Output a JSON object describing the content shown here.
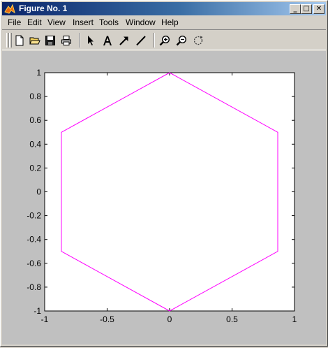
{
  "window": {
    "title": "Figure No. 1",
    "icons": {
      "app": "matlab-logo-icon",
      "minimize": "minimize-icon",
      "maximize": "maximize-icon",
      "close": "close-icon"
    },
    "controls": {
      "minimize": "_",
      "maximize": "□",
      "close": "✕"
    }
  },
  "menu": {
    "items": [
      {
        "label": "File",
        "name": "menu-file"
      },
      {
        "label": "Edit",
        "name": "menu-edit"
      },
      {
        "label": "View",
        "name": "menu-view"
      },
      {
        "label": "Insert",
        "name": "menu-insert"
      },
      {
        "label": "Tools",
        "name": "menu-tools"
      },
      {
        "label": "Window",
        "name": "menu-window"
      },
      {
        "label": "Help",
        "name": "menu-help"
      }
    ]
  },
  "toolbar": {
    "buttons": [
      {
        "name": "new-figure-button",
        "icon": "new-file-icon"
      },
      {
        "name": "open-file-button",
        "icon": "folder-open-icon"
      },
      {
        "name": "save-button",
        "icon": "floppy-disk-icon"
      },
      {
        "name": "print-button",
        "icon": "printer-icon"
      },
      {
        "name": "edit-plot-button",
        "icon": "arrow-pointer-icon"
      },
      {
        "name": "insert-text-button",
        "icon": "text-A-icon"
      },
      {
        "name": "insert-arrow-button",
        "icon": "arrow-icon"
      },
      {
        "name": "insert-line-button",
        "icon": "line-icon"
      },
      {
        "name": "zoom-in-button",
        "icon": "zoom-in-icon"
      },
      {
        "name": "zoom-out-button",
        "icon": "zoom-out-icon"
      },
      {
        "name": "rotate-3d-button",
        "icon": "rotate-icon"
      }
    ]
  },
  "colors": {
    "plot_line": "#ff00ff",
    "figure_bg": "#c0c0c0",
    "axes_bg": "#ffffff",
    "title_bar": "#0a246a"
  },
  "chart_data": {
    "type": "line",
    "title": "",
    "xlabel": "",
    "ylabel": "",
    "xlim": [
      -1,
      1
    ],
    "ylim": [
      -1,
      1
    ],
    "grid": false,
    "xticks": [
      -1,
      -0.5,
      0,
      0.5,
      1
    ],
    "xtick_labels": [
      "-1",
      "-0.5",
      "0",
      "0.5",
      "1"
    ],
    "yticks": [
      -1,
      -0.8,
      -0.6,
      -0.4,
      -0.2,
      0,
      0.2,
      0.4,
      0.6,
      0.8,
      1
    ],
    "ytick_labels": [
      "-1",
      "-0.8",
      "-0.6",
      "-0.4",
      "-0.2",
      "0",
      "0.2",
      "0.4",
      "0.6",
      "0.8",
      "1"
    ],
    "series": [
      {
        "color": "#ff00ff",
        "x": [
          0,
          0.866,
          0.866,
          0,
          -0.866,
          -0.866,
          0
        ],
        "y": [
          1,
          0.5,
          -0.5,
          -1,
          -0.5,
          0.5,
          1
        ]
      }
    ]
  }
}
